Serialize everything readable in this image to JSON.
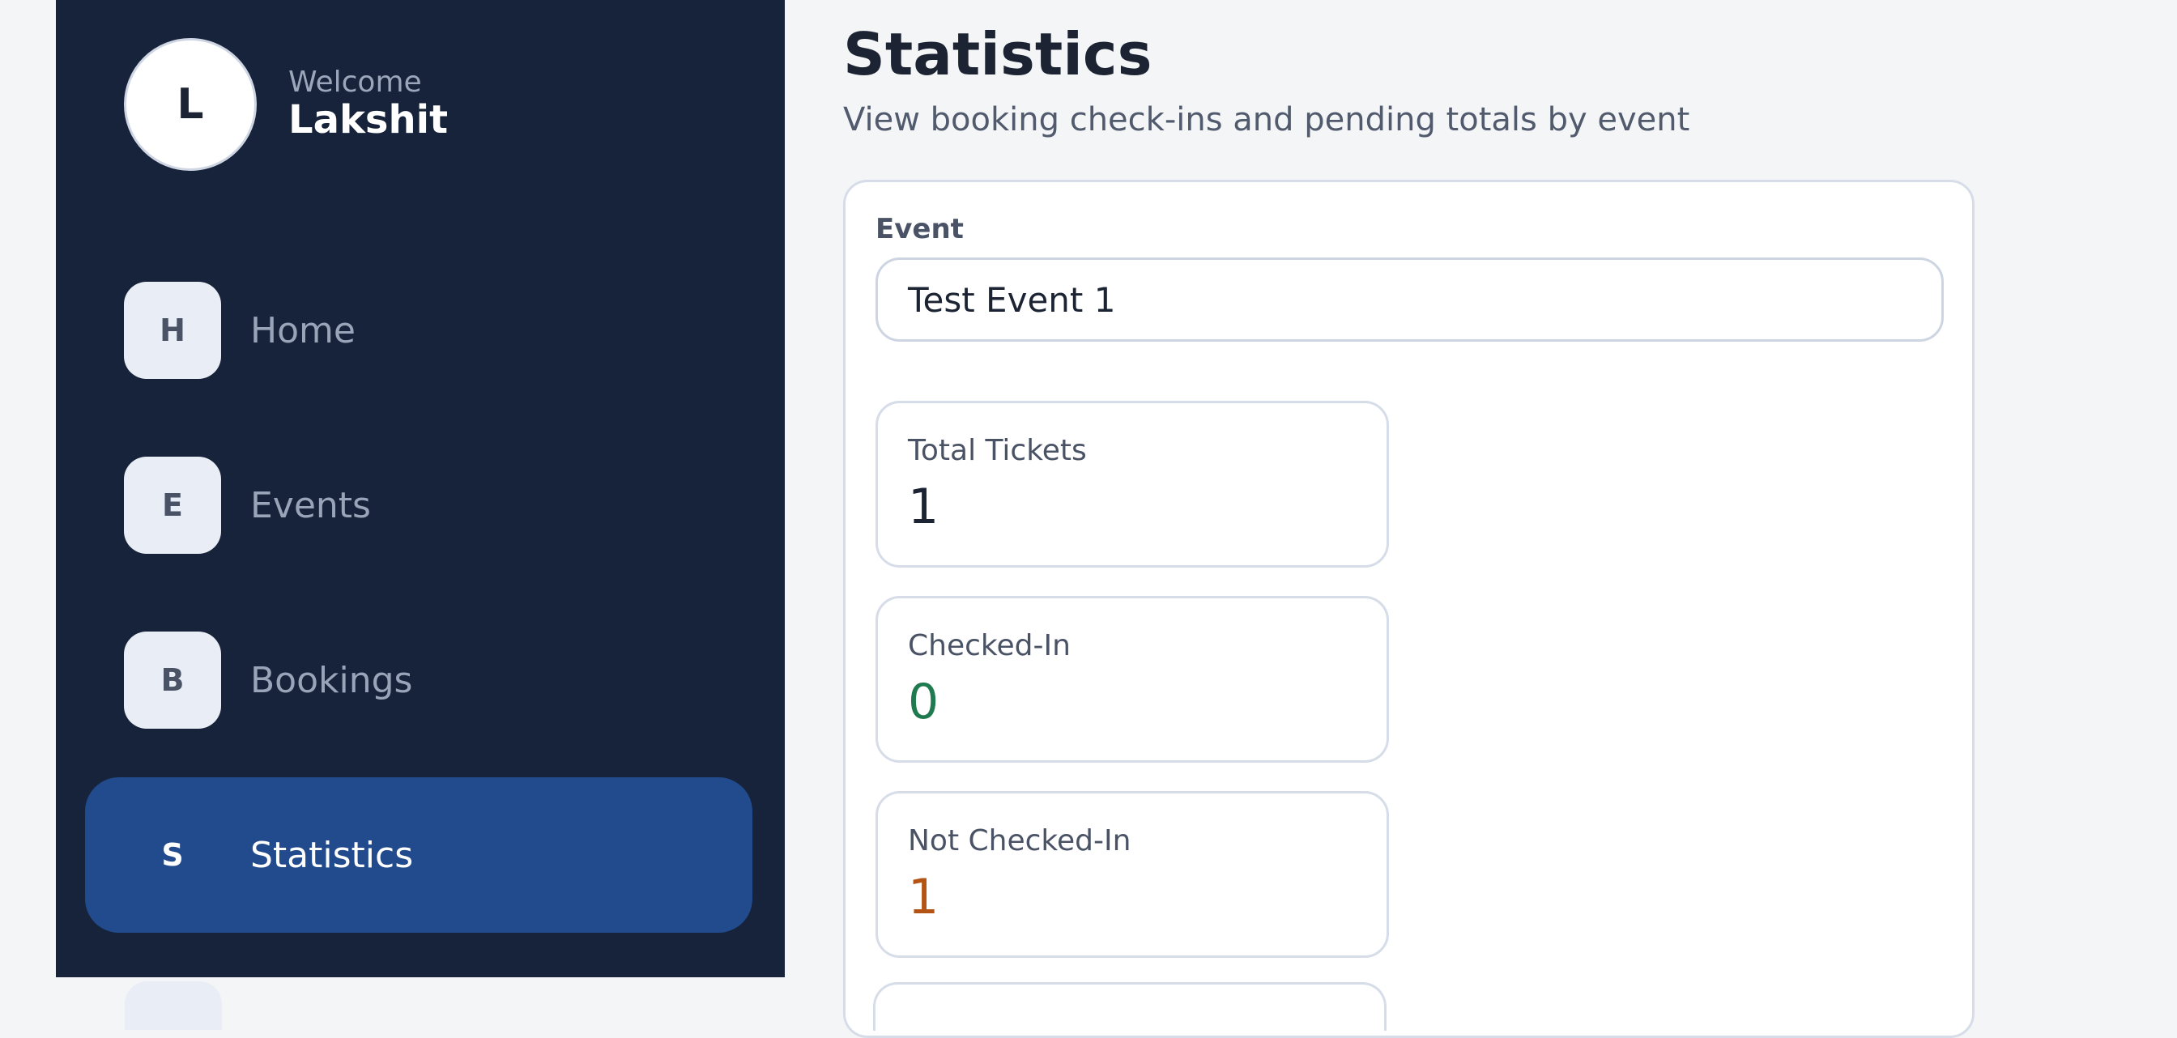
{
  "sidebar": {
    "profile": {
      "avatar_initial": "L",
      "welcome_label": "Welcome",
      "user_name": "Lakshit"
    },
    "items": [
      {
        "badge": "H",
        "label": "Home",
        "active": false
      },
      {
        "badge": "E",
        "label": "Events",
        "active": false
      },
      {
        "badge": "B",
        "label": "Bookings",
        "active": false
      },
      {
        "badge": "S",
        "label": "Statistics",
        "active": true
      }
    ]
  },
  "main": {
    "title": "Statistics",
    "subtitle": "View booking check-ins and pending totals by event",
    "event_field": {
      "label": "Event",
      "value": "Test Event 1"
    },
    "stats": [
      {
        "label": "Total Tickets",
        "value": "1",
        "color": "#1c2433"
      },
      {
        "label": "Checked-In",
        "value": "0",
        "color": "#1f7a4f"
      },
      {
        "label": "Not Checked-In",
        "value": "1",
        "color": "#b35414"
      }
    ]
  },
  "colors": {
    "sidebar_bg": "#17233a",
    "active_item_bg": "#214b8d",
    "page_bg": "#f4f5f7"
  }
}
